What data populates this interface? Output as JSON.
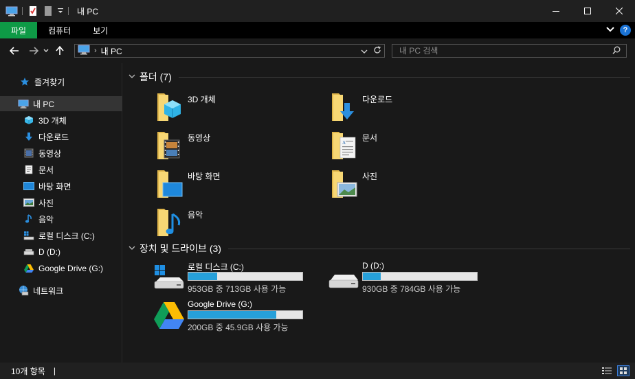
{
  "window": {
    "title": "내 PC",
    "controls": {
      "minimize": "—",
      "maximize": "☐",
      "close": "✕"
    }
  },
  "ribbon": {
    "tabs": [
      {
        "label": "파일"
      },
      {
        "label": "컴퓨터"
      },
      {
        "label": "보기"
      }
    ],
    "help": "?"
  },
  "address": {
    "path": [
      "내 PC"
    ],
    "search_placeholder": "내 PC 검색"
  },
  "navpane": {
    "quick_access": "즐겨찾기",
    "this_pc": "내 PC",
    "items": [
      {
        "label": "3D 개체",
        "icon": "cube-icon"
      },
      {
        "label": "다운로드",
        "icon": "download-icon"
      },
      {
        "label": "동영상",
        "icon": "video-icon"
      },
      {
        "label": "문서",
        "icon": "document-icon"
      },
      {
        "label": "바탕 화면",
        "icon": "desktop-icon"
      },
      {
        "label": "사진",
        "icon": "picture-icon"
      },
      {
        "label": "음악",
        "icon": "music-icon"
      },
      {
        "label": "로컬 디스크 (C:)",
        "icon": "windows-drive-icon"
      },
      {
        "label": "D (D:)",
        "icon": "drive-icon"
      },
      {
        "label": "Google Drive (G:)",
        "icon": "google-drive-icon"
      }
    ],
    "network": "네트워크"
  },
  "folders": {
    "title": "폴더 (7)",
    "items": [
      {
        "label": "3D 개체",
        "icon": "folder-3d-icon"
      },
      {
        "label": "다운로드",
        "icon": "folder-download-icon"
      },
      {
        "label": "동영상",
        "icon": "folder-video-icon"
      },
      {
        "label": "문서",
        "icon": "folder-document-icon"
      },
      {
        "label": "바탕 화면",
        "icon": "folder-desktop-icon"
      },
      {
        "label": "사진",
        "icon": "folder-picture-icon"
      },
      {
        "label": "음악",
        "icon": "folder-music-icon"
      }
    ]
  },
  "drives": {
    "title": "장치 및 드라이브 (3)",
    "items": [
      {
        "name": "로컬 디스크 (C:)",
        "info": "953GB 중 713GB 사용 가능",
        "used_fraction": 0.252,
        "icon": "windows-drive-icon"
      },
      {
        "name": "D (D:)",
        "info": "930GB 중 784GB 사용 가능",
        "used_fraction": 0.157,
        "icon": "drive-icon"
      },
      {
        "name": "Google Drive (G:)",
        "info": "200GB 중 45.9GB 사용 가능",
        "used_fraction": 0.77,
        "icon": "google-drive-icon"
      }
    ]
  },
  "status": {
    "count": "10개 항목",
    "cursor": "|"
  },
  "colors": {
    "file_tab": "#0e9a46",
    "bar_fill": "#26a0da",
    "help": "#1a73d6"
  }
}
